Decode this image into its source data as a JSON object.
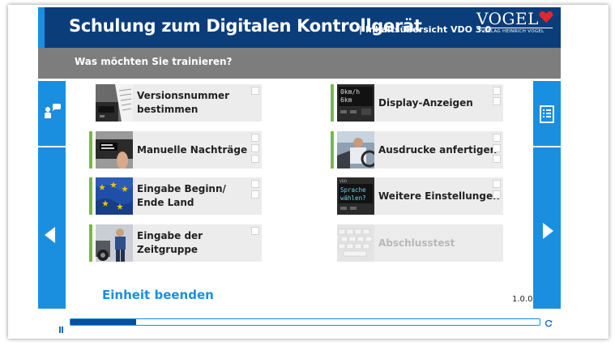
{
  "header": {
    "title": "Schulung zum Digitalen Kontrollgerät",
    "subtitle": "| Inhaltsübersicht VDO 3.0",
    "logo": "VOGEL",
    "logo_sub": "VERLAG HEINRICH VOGEL"
  },
  "subheader": {
    "prompt": "Was möchten Sie trainieren?"
  },
  "modules": [
    {
      "label_line1": "Versionsnummer",
      "label_line2": "bestimmen",
      "completed": false,
      "enabled": true,
      "image": "tachograph-receipt-photo",
      "checks": 1
    },
    {
      "label_line1": "Manuelle Nachträge",
      "label_line2": "",
      "completed": true,
      "enabled": true,
      "image": "finger-on-device-photo",
      "checks": 4
    },
    {
      "label_line1": "Eingabe Beginn/",
      "label_line2": "Ende Land",
      "completed": true,
      "enabled": true,
      "image": "eu-flag-photo",
      "checks": 2
    },
    {
      "label_line1": "Eingabe der Zeitgruppe",
      "label_line2": "",
      "completed": true,
      "enabled": true,
      "image": "driver-at-truck-photo",
      "checks": 1
    },
    {
      "label_line1": "Display-Anzeigen",
      "label_line2": "",
      "completed": true,
      "enabled": true,
      "image": "display-6km-photo",
      "checks": 2
    },
    {
      "label_line1": "Ausdrucke anfertigen",
      "label_line2": "",
      "completed": true,
      "enabled": true,
      "image": "driver-in-cab-photo",
      "checks": 4
    },
    {
      "label_line1": "Weitere Einstellungen",
      "label_line2": "",
      "completed": false,
      "enabled": true,
      "image": "display-sprache-photo",
      "checks": 3
    },
    {
      "label_line1": "Abschlusstest",
      "label_line2": "",
      "completed": false,
      "enabled": false,
      "image": "keyboard-photo",
      "checks": 0
    }
  ],
  "display_texts": {
    "display_6km": [
      "0km/h",
      "6km"
    ],
    "display_sprache": [
      "Sprache",
      "wählen?"
    ],
    "vdo": "VDO"
  },
  "footer": {
    "end_label": "Einheit beenden",
    "version": "1.0.0"
  },
  "player": {
    "progress": 0.14
  },
  "colors": {
    "header_bg": "#0a3d7a",
    "accent_blue": "#1a8fe0",
    "subheader_bg": "#7d7d7d",
    "completed_green": "#7ab648",
    "logo_heart": "#e3262e"
  },
  "icons": {
    "left_top": "person-speech-icon",
    "right_top": "document-list-icon",
    "prev": "arrow-left-icon",
    "next": "arrow-right-icon",
    "pause": "pause-icon",
    "reload": "reload-icon"
  }
}
